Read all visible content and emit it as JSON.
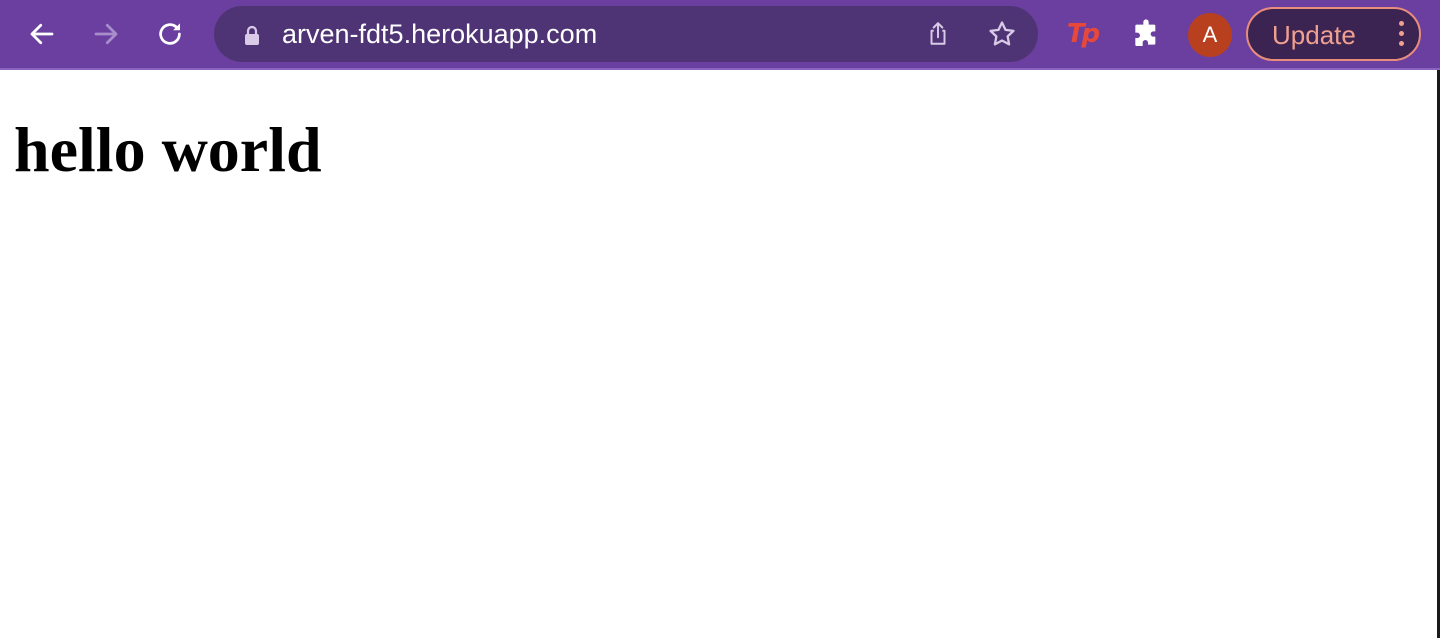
{
  "browser": {
    "toolbar_color": "#6b3fa0",
    "address_bar": {
      "url": "arven-fdt5.herokuapp.com",
      "icons": [
        "lock-icon",
        "share-icon",
        "bookmark-star-icon"
      ]
    },
    "nav_icons": [
      "back-arrow-icon",
      "forward-arrow-icon",
      "reload-icon"
    ],
    "extensions": [
      {
        "name": "tp-extension-icon",
        "label": "Tp",
        "color": "#e8483a"
      },
      {
        "name": "puzzle-icon"
      }
    ],
    "profile": {
      "initial": "A",
      "color": "#b8401f"
    },
    "update_button": {
      "label": "Update",
      "accent": "#f0a090"
    }
  },
  "page": {
    "heading": "hello world"
  }
}
